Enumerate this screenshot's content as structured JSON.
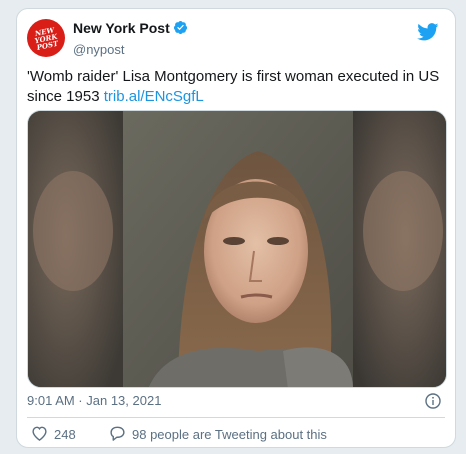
{
  "account": {
    "display_name": "New York Post",
    "handle": "@nypost",
    "logo_text": [
      "NEW",
      "YORK",
      "POST"
    ]
  },
  "tweet": {
    "text": "'Womb raider' Lisa Montgomery is first woman executed in US since 1953 ",
    "link": "trib.al/ENcSgfL"
  },
  "meta": {
    "timestamp": "9:01 AM · Jan 13, 2021"
  },
  "actions": {
    "likes": "248",
    "conversation": "98 people are Tweeting about this"
  },
  "icons": {
    "verified": "verified-badge-icon",
    "bird": "twitter-bird-icon",
    "info": "info-icon",
    "heart": "heart-icon",
    "comment": "comment-bubble-icon"
  },
  "colors": {
    "accent": "#1da1f2",
    "link": "#1b95e0",
    "secondary_text": "#5b7083",
    "brand_red": "#d91e18"
  }
}
